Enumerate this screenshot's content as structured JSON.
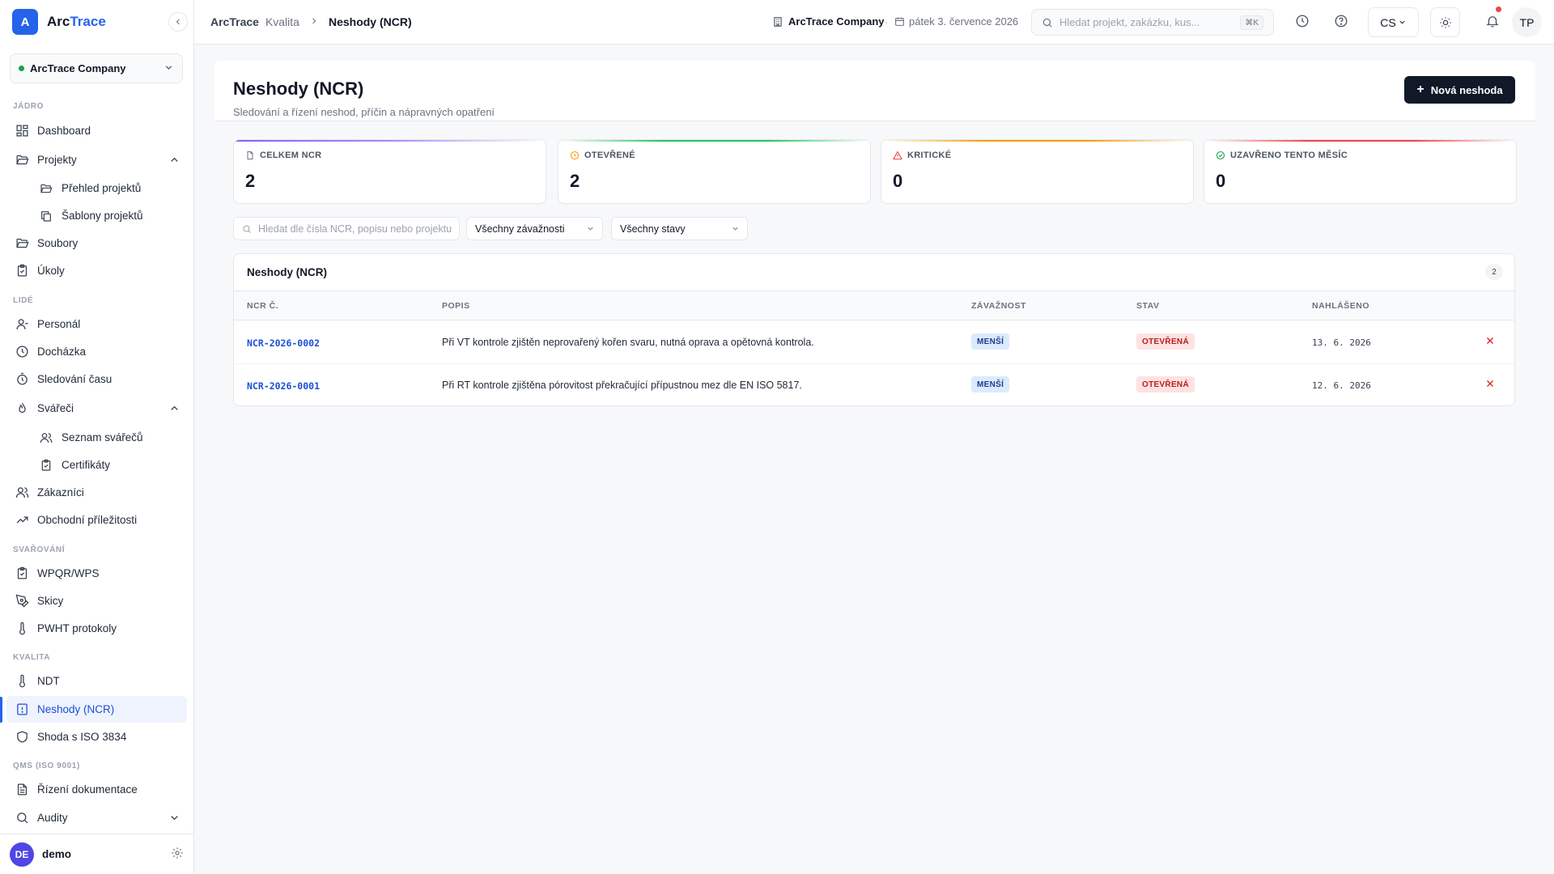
{
  "brand": {
    "logo_letter": "A",
    "name_prefix": "Arc",
    "name_suffix": "Trace"
  },
  "sidebar": {
    "company": "ArcTrace Company",
    "sections": {
      "core": "JÁDRO",
      "people": "LIDÉ",
      "welding": "SVAŘOVÁNÍ",
      "quality": "KVALITA",
      "qms": "QMS (ISO 9001)"
    },
    "items": {
      "dashboard": "Dashboard",
      "projects": "Projekty",
      "projects_overview": "Přehled projektů",
      "project_templates": "Šablony projektů",
      "files": "Soubory",
      "tasks": "Úkoly",
      "personnel": "Personál",
      "attendance": "Docházka",
      "time_tracking": "Sledování času",
      "welders": "Svářeči",
      "welders_list": "Seznam svářečů",
      "certificates": "Certifikáty",
      "customers": "Zákazníci",
      "opportunities": "Obchodní příležitosti",
      "wpqr": "WPQR/WPS",
      "sketches": "Skicy",
      "pwht": "PWHT protokoly",
      "ndt": "NDT",
      "ncr": "Neshody (NCR)",
      "iso3834": "Shoda s ISO 3834",
      "doc_control": "Řízení dokumentace",
      "audits": "Audity"
    },
    "user": {
      "initials": "DE",
      "name": "demo"
    }
  },
  "topbar": {
    "breadcrumb": {
      "root": "ArcTrace",
      "parent": "Kvalita",
      "current": "Neshody (NCR)"
    },
    "company": "ArcTrace Company",
    "separator": "·",
    "date": "pátek 3. července 2026",
    "search_placeholder": "Hledat projekt, zakázku, kus...",
    "shortcut": "⌘K",
    "language": "CS",
    "user_initials": "TP"
  },
  "page": {
    "title": "Neshody (NCR)",
    "subtitle": "Sledování a řízení neshod, příčin a nápravných opatření",
    "new_button": "Nová neshoda"
  },
  "stats": [
    {
      "label": "CELKEM NCR",
      "value": "2",
      "color": "#8b5cf6"
    },
    {
      "label": "OTEVŘENÉ",
      "value": "2",
      "color": "#22c55e"
    },
    {
      "label": "KRITICKÉ",
      "value": "0",
      "color": "#f59e0b"
    },
    {
      "label": "UZAVŘENO TENTO MĚSÍC",
      "value": "0",
      "color": "#ef4444"
    }
  ],
  "filters": {
    "search_placeholder": "Hledat dle čísla NCR, popisu nebo projektu",
    "severity": "Všechny závažnosti",
    "status": "Všechny stavy"
  },
  "table": {
    "title": "Neshody (NCR)",
    "count": "2",
    "columns": [
      "NCR Č.",
      "POPIS",
      "ZÁVAŽNOST",
      "STAV",
      "NAHLÁŠENO"
    ],
    "rows": [
      {
        "id": "NCR-2026-0002",
        "description": "Při VT kontrole zjištěn neprovařený kořen svaru, nutná oprava a opětovná kontrola.",
        "severity": "MENŠÍ",
        "status": "OTEVŘENÁ",
        "reported": "13. 6. 2026"
      },
      {
        "id": "NCR-2026-0001",
        "description": "Při RT kontrole zjištěna pórovitost překračující přípustnou mez dle EN ISO 5817.",
        "severity": "MENŠÍ",
        "status": "OTEVŘENÁ",
        "reported": "12. 6. 2026"
      }
    ]
  }
}
